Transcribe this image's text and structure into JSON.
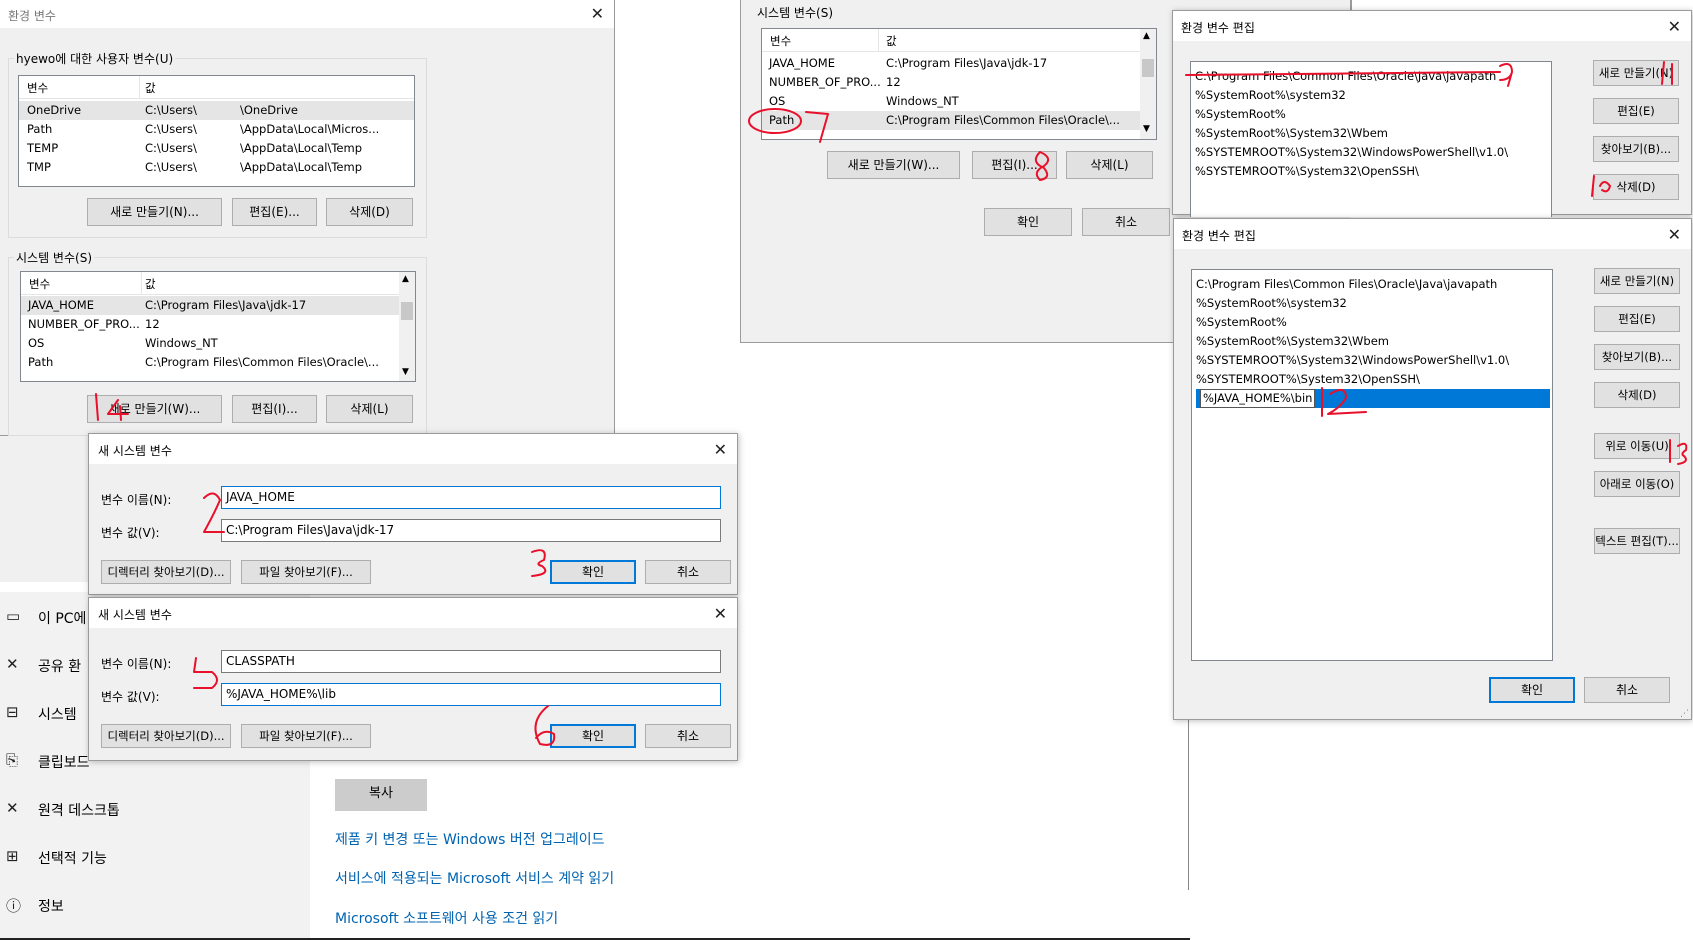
{
  "env_window": {
    "title": "환경 변수",
    "user_group_label": "hyewo에 대한 사용자 변수(U)",
    "user_columns": [
      "변수",
      "값"
    ],
    "user_rows": [
      {
        "name": "OneDrive",
        "value_a": "C:\\Users\\",
        "value_b": "\\OneDrive"
      },
      {
        "name": "Path",
        "value_a": "C:\\Users\\",
        "value_b": "\\AppData\\Local\\Micros..."
      },
      {
        "name": "TEMP",
        "value_a": "C:\\Users\\",
        "value_b": "\\AppData\\Local\\Temp"
      },
      {
        "name": "TMP",
        "value_a": "C:\\Users\\",
        "value_b": "\\AppData\\Local\\Temp"
      }
    ],
    "user_buttons": {
      "new": "새로 만들기(N)...",
      "edit": "편집(E)...",
      "delete": "삭제(D)"
    },
    "sys_group_label": "시스템 변수(S)",
    "sys_columns": [
      "변수",
      "값"
    ],
    "sys_rows": [
      {
        "name": "JAVA_HOME",
        "value": "C:\\Program Files\\Java\\jdk-17"
      },
      {
        "name": "NUMBER_OF_PRO...",
        "value": "12"
      },
      {
        "name": "OS",
        "value": "Windows_NT"
      },
      {
        "name": "Path",
        "value": "C:\\Program Files\\Common Files\\Oracle\\..."
      }
    ],
    "sys_buttons": {
      "new": "새로 만들기(W)...",
      "edit": "편집(I)...",
      "delete": "삭제(L)"
    }
  },
  "env_window2": {
    "sys_group_label": "시스템 변수(S)",
    "columns": [
      "변수",
      "값"
    ],
    "rows": [
      {
        "name": "JAVA_HOME",
        "value": "C:\\Program Files\\Java\\jdk-17"
      },
      {
        "name": "NUMBER_OF_PRO...",
        "value": "12"
      },
      {
        "name": "OS",
        "value": "Windows_NT"
      },
      {
        "name": "Path",
        "value": "C:\\Program Files\\Common Files\\Oracle\\..."
      }
    ],
    "buttons": {
      "new": "새로 만들기(W)...",
      "edit": "편집(I)...",
      "delete": "삭제(L)",
      "ok": "확인",
      "cancel": "취소"
    }
  },
  "new_var_dialog1": {
    "title": "새 시스템 변수",
    "name_label": "변수 이름(N):",
    "name_value": "JAVA_HOME",
    "value_label": "변수 값(V):",
    "value_value": "C:\\Program Files\\Java\\jdk-17",
    "browse_dir": "디렉터리 찾아보기(D)...",
    "browse_file": "파일 찾아보기(F)...",
    "ok": "확인",
    "cancel": "취소"
  },
  "new_var_dialog2": {
    "title": "새 시스템 변수",
    "name_label": "변수 이름(N):",
    "name_value": "CLASSPATH",
    "value_label": "변수 값(V):",
    "value_value": "%JAVA_HOME%\\lib",
    "browse_dir": "디렉터리 찾아보기(D)...",
    "browse_file": "파일 찾아보기(F)...",
    "ok": "확인",
    "cancel": "취소"
  },
  "edit_dialog1": {
    "title": "환경 변수 편집",
    "items": [
      "C:\\Program Files\\Common Files\\Oracle\\Java\\javapath",
      "%SystemRoot%\\system32",
      "%SystemRoot%",
      "%SystemRoot%\\System32\\Wbem",
      "%SYSTEMROOT%\\System32\\WindowsPowerShell\\v1.0\\",
      "%SYSTEMROOT%\\System32\\OpenSSH\\"
    ],
    "buttons": {
      "new": "새로 만들기(N)",
      "edit": "편집(E)",
      "browse": "찾아보기(B)...",
      "delete": "삭제(D)"
    }
  },
  "edit_dialog2": {
    "title": "환경 변수 편집",
    "items": [
      "C:\\Program Files\\Common Files\\Oracle\\Java\\javapath",
      "%SystemRoot%\\system32",
      "%SystemRoot%",
      "%SystemRoot%\\System32\\Wbem",
      "%SYSTEMROOT%\\System32\\WindowsPowerShell\\v1.0\\",
      "%SYSTEMROOT%\\System32\\OpenSSH\\"
    ],
    "editing_item": "%JAVA_HOME%\\bin",
    "buttons": {
      "new": "새로 만들기(N)",
      "edit": "편집(E)",
      "browse": "찾아보기(B)...",
      "delete": "삭제(D)",
      "up": "위로 이동(U)",
      "down": "아래로 이동(O)",
      "text_edit": "텍스트 편집(T)...",
      "ok": "확인",
      "cancel": "취소"
    }
  },
  "settings": {
    "nav": [
      {
        "icon": "pc-icon",
        "label": "이 PC에"
      },
      {
        "icon": "share-icon",
        "label": "공유 환"
      },
      {
        "icon": "system-icon",
        "label": "시스템"
      },
      {
        "icon": "clipboard-icon",
        "label": "클립보드"
      },
      {
        "icon": "remote-desktop-icon",
        "label": "원격 데스크톱"
      },
      {
        "icon": "optional-features-icon",
        "label": "선택적 기능"
      },
      {
        "icon": "info-icon",
        "label": "정보"
      }
    ],
    "copy_button": "복사",
    "links": [
      "제품 키 변경 또는 Windows 버전 업그레이드",
      "서비스에 적용되는 Microsoft 서비스 계약 읽기",
      "Microsoft 소프트웨어 사용 조건 읽기"
    ]
  },
  "annotations": [
    "1",
    "2",
    "3",
    "4",
    "5",
    "6",
    "7",
    "8",
    "9",
    "10",
    "11",
    "12",
    "13"
  ],
  "colors": {
    "annotation": "#e8102a",
    "accent": "#0078d7",
    "link": "#0063b1"
  }
}
